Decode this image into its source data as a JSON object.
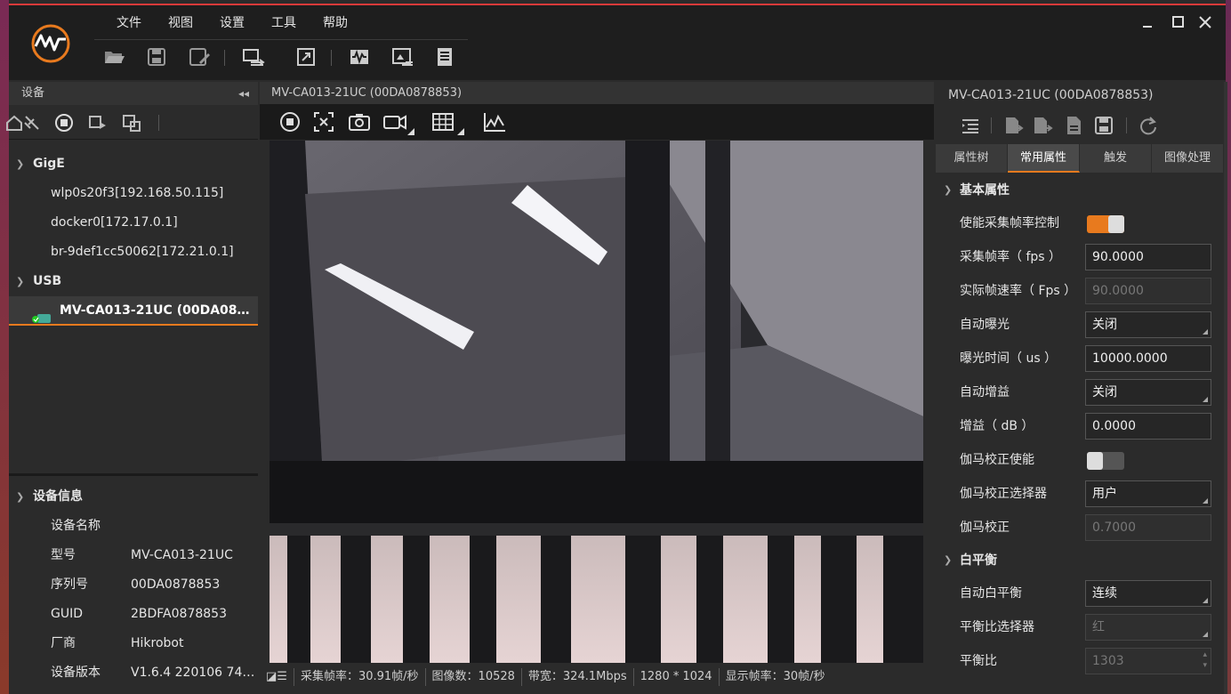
{
  "app": {
    "menu": [
      "文件",
      "视图",
      "设置",
      "工具",
      "帮助"
    ]
  },
  "colors": {
    "accent": "#e87a1e",
    "titlebar": "#1e1e1e",
    "panel": "#2b2b2b"
  },
  "left_panel": {
    "title": "设备",
    "tree": [
      {
        "group": "GigE",
        "items": [
          "wlp0s20f3[192.168.50.115]",
          "docker0[172.17.0.1]",
          "br-9def1cc50062[172.21.0.1]"
        ]
      },
      {
        "group": "USB",
        "items": [
          "MV-CA013-21UC (00DA0878..."
        ]
      }
    ],
    "info_title": "设备信息",
    "info": [
      {
        "k": "设备名称",
        "v": ""
      },
      {
        "k": "型号",
        "v": "MV-CA013-21UC"
      },
      {
        "k": "序列号",
        "v": "00DA0878853"
      },
      {
        "k": "GUID",
        "v": "2BDFA0878853"
      },
      {
        "k": "厂商",
        "v": "Hikrobot"
      },
      {
        "k": "设备版本",
        "v": "V1.6.4 220106 747..."
      }
    ]
  },
  "center": {
    "title": "MV-CA013-21UC (00DA0878853)",
    "status": [
      "采集帧率：30.91帧/秒",
      "图像数：10528",
      "带宽：324.1Mbps",
      "1280 * 1024",
      "显示帧率：30帧/秒"
    ]
  },
  "right_panel": {
    "title": "MV-CA013-21UC (00DA0878853)",
    "tabs": [
      "属性树",
      "常用属性",
      "触发",
      "图像处理"
    ],
    "active_tab": 1,
    "group1": "基本属性",
    "group2": "白平衡",
    "props": [
      {
        "label": "使能采集帧率控制",
        "type": "toggle",
        "on": true
      },
      {
        "label": "采集帧率（ fps ）",
        "value": "90.0000"
      },
      {
        "label": "实际帧速率（ Fps ）",
        "value": "90.0000",
        "disabled": true
      },
      {
        "label": "自动曝光",
        "value": "关闭",
        "select": true
      },
      {
        "label": "曝光时间（ us ）",
        "value": "10000.0000"
      },
      {
        "label": "自动增益",
        "value": "关闭",
        "select": true
      },
      {
        "label": "增益（ dB ）",
        "value": "0.0000"
      },
      {
        "label": "伽马校正使能",
        "type": "toggle",
        "on": false
      },
      {
        "label": "伽马校正选择器",
        "value": "用户",
        "select": true
      },
      {
        "label": "伽马校正",
        "value": "0.7000",
        "disabled": true
      }
    ],
    "wb_props": [
      {
        "label": "自动白平衡",
        "value": "连续",
        "select": true
      },
      {
        "label": "平衡比选择器",
        "value": "红",
        "select": true,
        "disabled": true
      },
      {
        "label": "平衡比",
        "value": "1303",
        "disabled": true,
        "spin": true
      }
    ]
  }
}
